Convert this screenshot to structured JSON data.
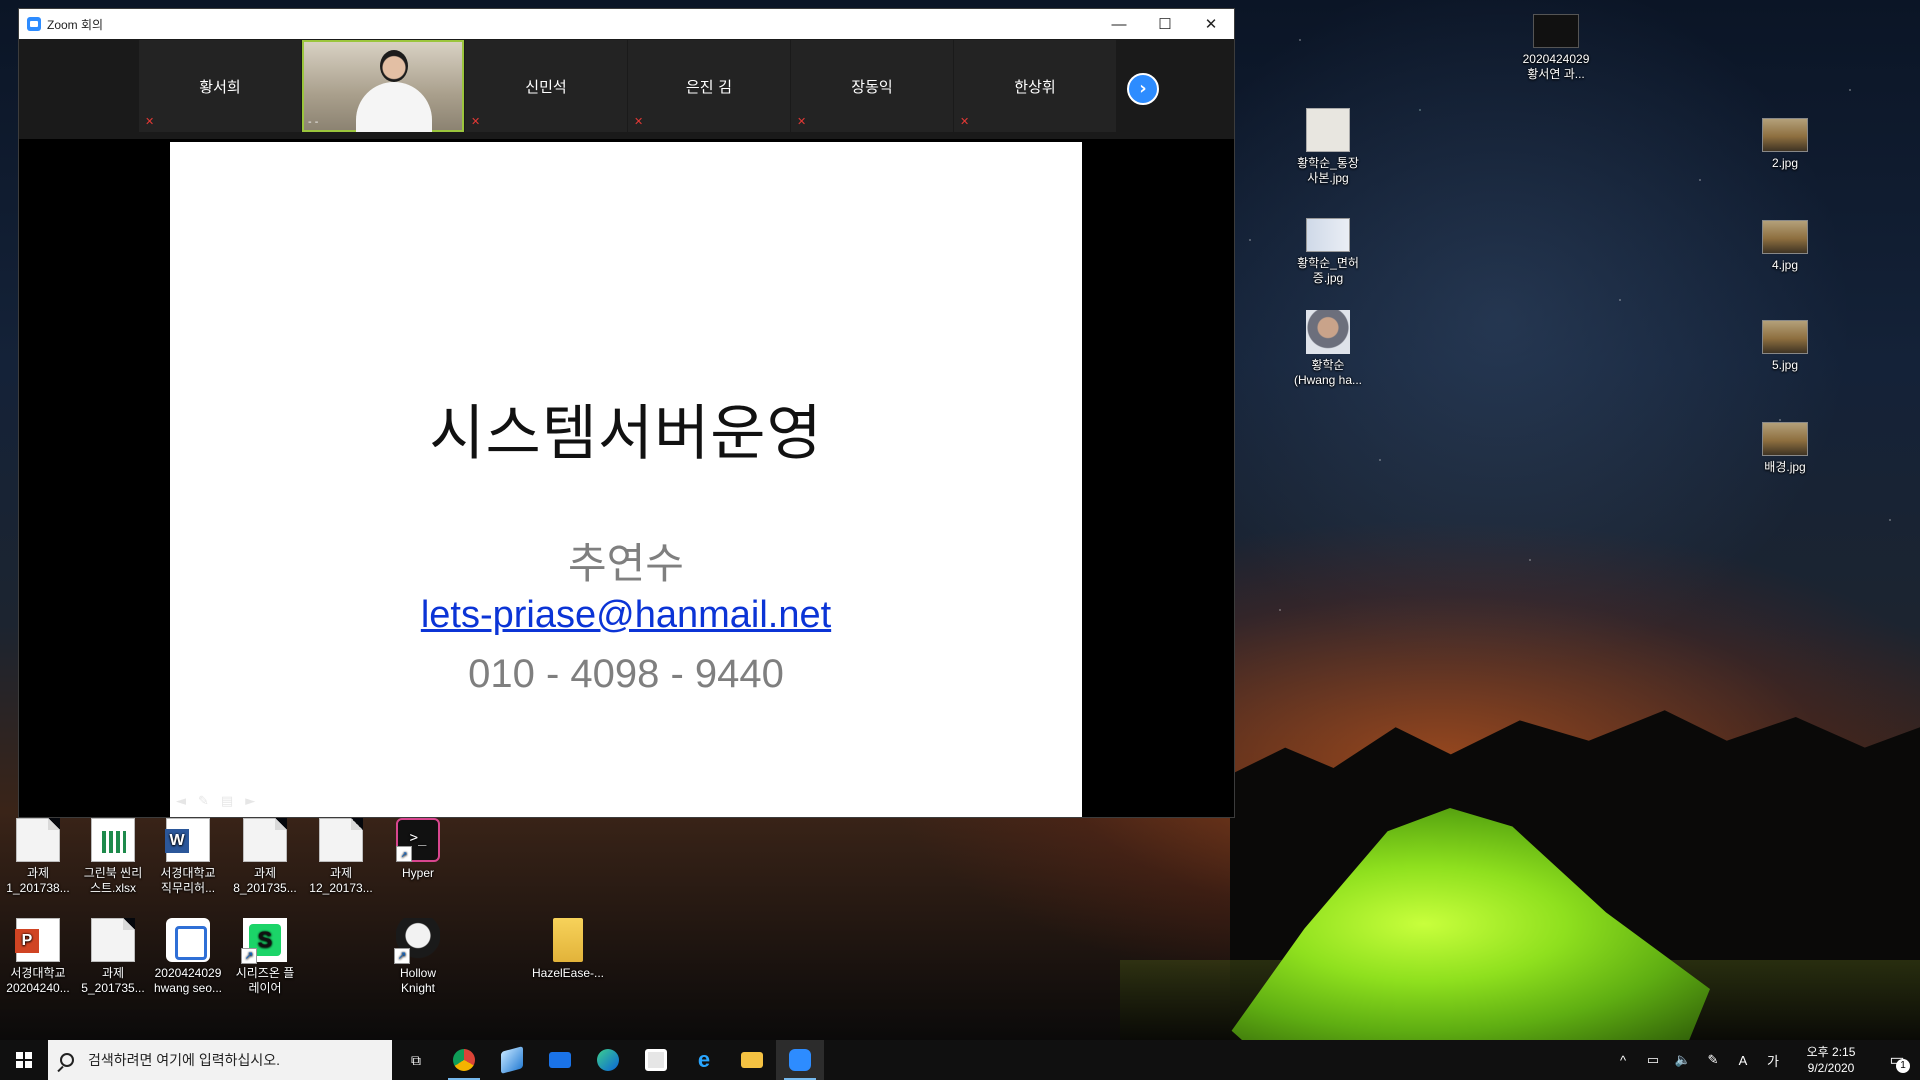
{
  "zoom": {
    "window_title": "Zoom 회의",
    "controls": {
      "minimize": "—",
      "maximize": "☐",
      "close": "✕"
    },
    "participants": [
      {
        "name": "황서희",
        "muted": true
      },
      {
        "name": "",
        "video": true,
        "caption": "- -"
      },
      {
        "name": "신민석",
        "muted": true
      },
      {
        "name": "은진 김",
        "muted": true
      },
      {
        "name": "장동익",
        "muted": true
      },
      {
        "name": "한상휘",
        "muted": true
      }
    ],
    "next_label": "›",
    "slide": {
      "title": "시스템서버운영",
      "presenter": "추연수",
      "email": "lets-priase@hanmail.net",
      "phone": "010 - 4098 - 9440"
    }
  },
  "desktop": {
    "left_icons": [
      {
        "label": "과제\n1_201738...",
        "type": "doc"
      },
      {
        "label": "그린북 씬리\n스트.xlsx",
        "type": "xls"
      },
      {
        "label": "서경대학교\n직무리허...",
        "type": "word"
      },
      {
        "label": "과제\n8_201735...",
        "type": "doc"
      },
      {
        "label": "과제\n12_20173...",
        "type": "doc"
      },
      {
        "label": "Hyper",
        "type": "hyper"
      },
      {
        "label": "서경대학교\n20204240...",
        "type": "ppt"
      },
      {
        "label": "과제\n5_201735...",
        "type": "doc"
      },
      {
        "label": "2020424029\nhwang seo...",
        "type": "note"
      },
      {
        "label": "시리즈온 플\n레이어",
        "type": "series"
      },
      {
        "label": "Hollow\nKnight",
        "type": "hollow"
      },
      {
        "label": "HazelEase-...",
        "type": "folder"
      }
    ],
    "right_icons": [
      {
        "label": "2020424029\n황서연 과...",
        "type": "video"
      },
      {
        "label": "황학순_통장\n사본.jpg",
        "type": "scan"
      },
      {
        "label": "황학순_면허\n증.jpg",
        "type": "idcard"
      },
      {
        "label": "황학순\n(Hwang ha...",
        "type": "face"
      },
      {
        "label": "2.jpg",
        "type": "photo"
      },
      {
        "label": "4.jpg",
        "type": "photo"
      },
      {
        "label": "5.jpg",
        "type": "photo"
      },
      {
        "label": "배경.jpg",
        "type": "photo"
      }
    ]
  },
  "taskbar": {
    "search_placeholder": "검색하려면 여기에 입력하십시오.",
    "apps": [
      "task-view",
      "chrome",
      "app",
      "mail",
      "edge",
      "store",
      "internet-explorer",
      "file-explorer",
      "zoom"
    ],
    "tray": {
      "up": "^",
      "ime": "A",
      "lang": "가"
    },
    "clock_time": "오후 2:15",
    "clock_date": "9/2/2020",
    "notifications": "1"
  },
  "colors": {
    "zoom_blue": "#2d8cff",
    "slide_link": "#0b34d6",
    "speaker_border": "#9bc53d",
    "muted_red": "#e53935"
  }
}
